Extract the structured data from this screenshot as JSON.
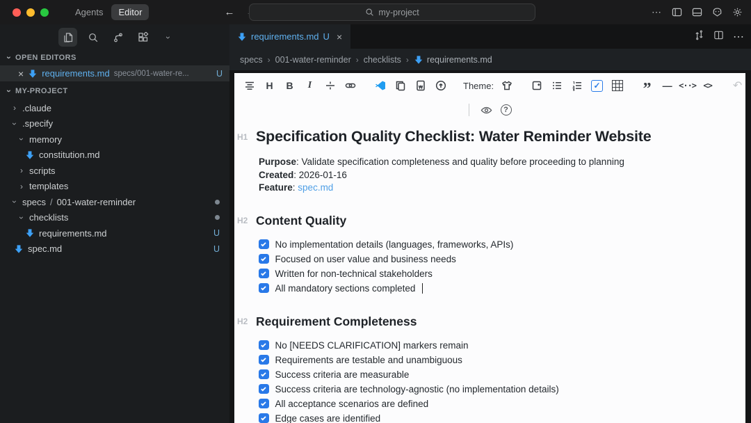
{
  "icons": {
    "chevron": "›",
    "close": "×",
    "ellipsis": "⋯",
    "back_arrow": "←",
    "forward_arrow": "→",
    "undo": "↶",
    "redo": "↷",
    "quote": "”",
    "hrule": "—",
    "inline_code": "<··>",
    "code_block": "<>",
    "heading": "H",
    "bold": "B",
    "italic": "I",
    "help": "?",
    "check": "✓"
  },
  "titlebar": {
    "tabs": [
      {
        "label": "Agents"
      },
      {
        "label": "Editor"
      }
    ],
    "search_value": "my-project"
  },
  "sidebar": {
    "open_editors_label": "OPEN EDITORS",
    "open_editor": {
      "name": "requirements.md",
      "path": "specs/001-water-re...",
      "badge": "U"
    },
    "project_label": "MY-PROJECT",
    "tree": [
      {
        "label": ".claude"
      },
      {
        "label": ".specify"
      },
      {
        "label": "memory"
      },
      {
        "label": "constitution.md"
      },
      {
        "label": "scripts"
      },
      {
        "label": "templates"
      },
      {
        "label": "specs",
        "sep": "/",
        "label2": "001-water-reminder"
      },
      {
        "label": "checklists"
      },
      {
        "label": "requirements.md",
        "badge": "U"
      },
      {
        "label": "spec.md",
        "badge": "U"
      }
    ]
  },
  "editor": {
    "tab": {
      "name": "requirements.md",
      "badge": "U"
    },
    "breadcrumbs": {
      "0": "specs",
      "1": "001-water-reminder",
      "2": "checklists",
      "3": "requirements.md"
    },
    "toolbar": {
      "theme_label": "Theme:"
    },
    "content": {
      "h1_gutter": "H1",
      "h1": "Specification Quality Checklist: Water Reminder Website",
      "meta_separator": ": ",
      "meta": [
        {
          "label": "Purpose",
          "value": "Validate specification completeness and quality before proceeding to planning"
        },
        {
          "label": "Created",
          "value": "2026-01-16"
        },
        {
          "label": "Feature",
          "value": "",
          "link": "spec.md"
        }
      ],
      "sections": [
        {
          "gutter": "H2",
          "title": "Content Quality",
          "items": [
            "No implementation details (languages, frameworks, APIs)",
            "Focused on user value and business needs",
            "Written for non-technical stakeholders",
            "All mandatory sections completed"
          ]
        },
        {
          "gutter": "H2",
          "title": "Requirement Completeness",
          "items": [
            "No [NEEDS CLARIFICATION] markers remain",
            "Requirements are testable and unambiguous",
            "Success criteria are measurable",
            "Success criteria are technology-agnostic (no implementation details)",
            "All acceptance scenarios are defined",
            "Edge cases are identified"
          ]
        }
      ]
    }
  },
  "colors": {
    "checkbox_blue": "#2979e8",
    "toolbar_check_blue": "#2b7de9",
    "file_blue": "#5fb0ee",
    "md_icon_blue": "#3da0f5",
    "link_blue": "#4f9fe6",
    "traffic_red": "#ff5f57",
    "traffic_yellow": "#febc2e",
    "traffic_green": "#28c840"
  }
}
